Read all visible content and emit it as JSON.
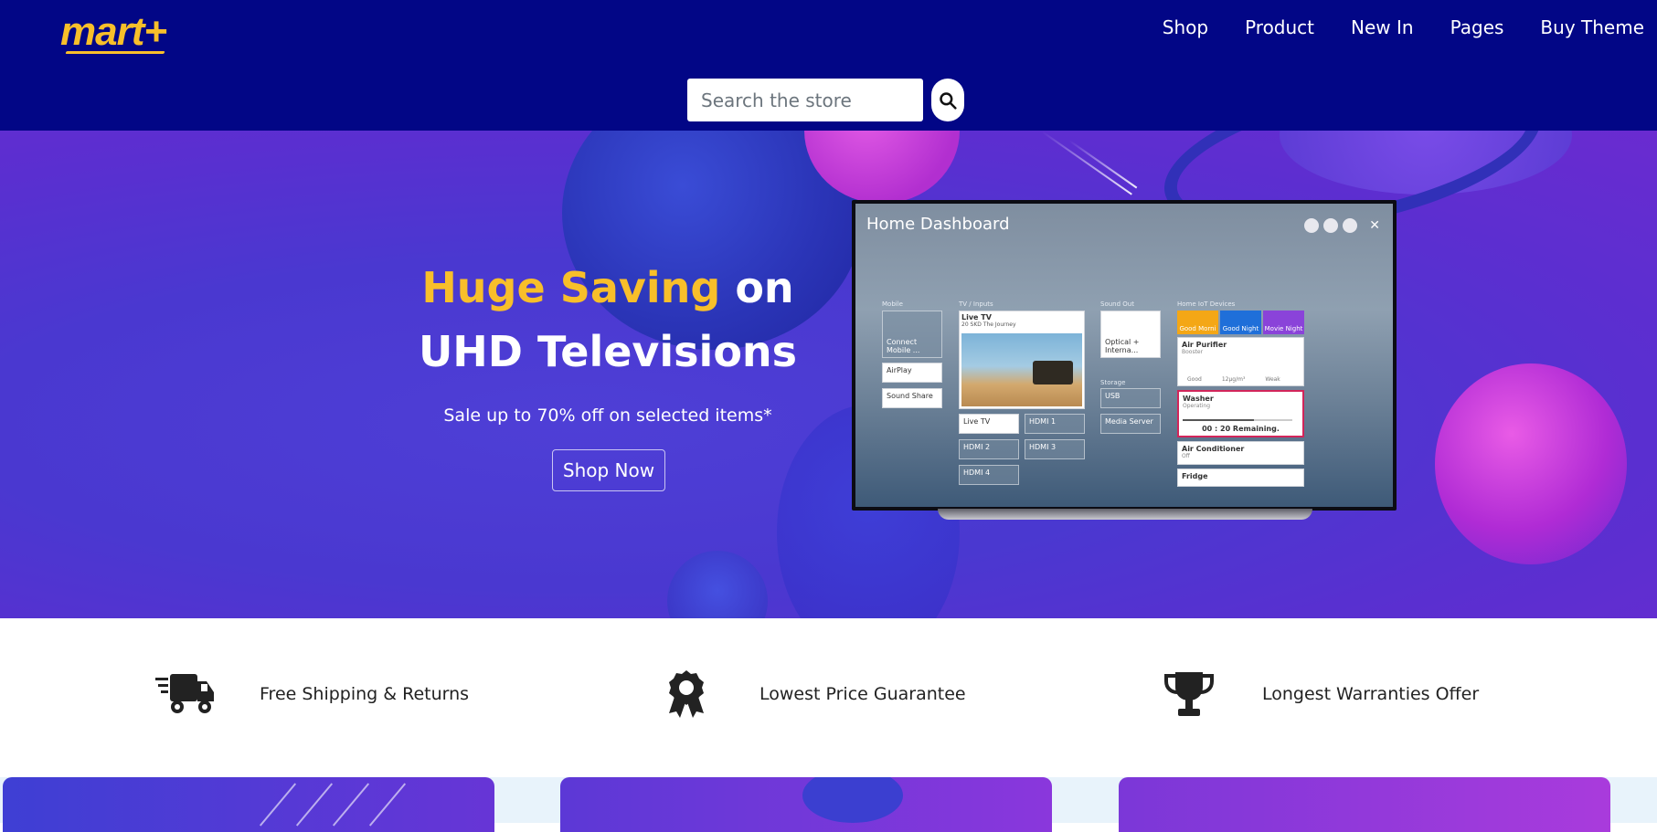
{
  "header": {
    "logo": "mart+",
    "nav": [
      "Shop",
      "Product",
      "New In",
      "Pages",
      "Buy Theme"
    ],
    "search_placeholder": "Search the store"
  },
  "hero": {
    "title_accent": "Huge Saving",
    "title_rest_line1": "on",
    "title_line2": "UHD Televisions",
    "subtitle": "Sale up to 70% off on selected items*",
    "cta": "Shop Now"
  },
  "tv": {
    "title": "Home Dashboard",
    "columns": {
      "mobile": "Mobile",
      "inputs": "TV / Inputs",
      "sound_out": "Sound Out",
      "storage": "Storage",
      "iot": "Home IoT Devices"
    },
    "mobile_tiles": [
      "Connect Mobile ...",
      "AirPlay",
      "Sound Share"
    ],
    "live_tv": "Live TV",
    "live_tv_channel": "20 SKD",
    "live_tv_show": "The Journey",
    "input_tiles": [
      "Live TV",
      "HDMI 1",
      "HDMI 2",
      "HDMI 3",
      "HDMI 4"
    ],
    "sound_tile": "Optical + Interna...",
    "storage_tiles": [
      "USB",
      "Media Server"
    ],
    "scenes": [
      "Good Morni",
      "Good Night",
      "Movie Night"
    ],
    "devices": [
      {
        "name": "Air Purifier",
        "status": "Booster",
        "extra": [
          "Good",
          "12µg/m³",
          "Weak"
        ]
      },
      {
        "name": "Washer",
        "status": "Operating",
        "extra": [
          "00 : 20 Remaining."
        ]
      },
      {
        "name": "Air Conditioner",
        "status": "Off"
      },
      {
        "name": "Fridge",
        "status": ""
      }
    ]
  },
  "features": [
    {
      "icon": "truck-icon",
      "label": "Free Shipping & Returns"
    },
    {
      "icon": "award-icon",
      "label": "Lowest Price Guarantee"
    },
    {
      "icon": "trophy-icon",
      "label": "Longest Warranties Offer"
    }
  ],
  "colors": {
    "header_bg": "#020686",
    "accent": "#f8bf2a",
    "hero_bg": "#4a38d0"
  }
}
